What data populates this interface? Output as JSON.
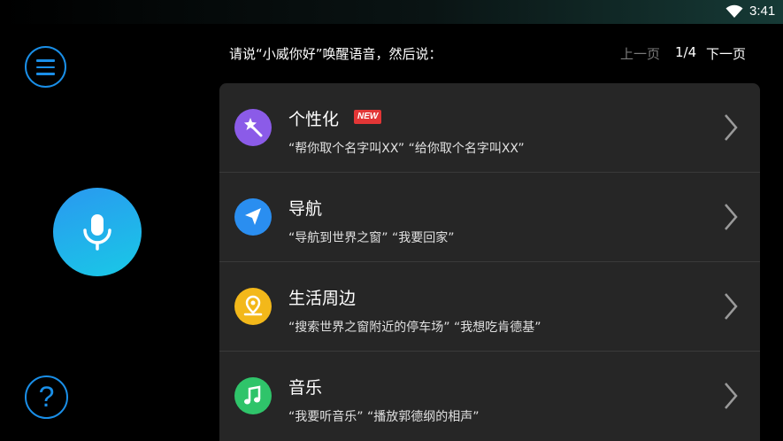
{
  "status_bar": {
    "time": "3:41",
    "wifi_icon": "wifi-icon"
  },
  "header": {
    "hint": "请说“小威你好”唤醒语音，然后说：",
    "prev_label": "上一页",
    "page_indicator": "1/4",
    "next_label": "下一页"
  },
  "sidebar": {
    "menu_icon": "hamburger-menu-icon",
    "mic_icon": "microphone-icon",
    "help_label": "?"
  },
  "items": [
    {
      "title": "个性化",
      "badge": "NEW",
      "subtitle": "“帮你取个名字叫XX” “给你取个名字叫XX”",
      "icon": "magic-wand-icon",
      "color": "#8b5be8"
    },
    {
      "title": "导航",
      "subtitle": "“导航到世界之窗” “我要回家”",
      "icon": "navigation-arrow-icon",
      "color": "#2a8ef0"
    },
    {
      "title": "生活周边",
      "subtitle": "“搜索世界之窗附近的停车场” “我想吃肯德基”",
      "icon": "location-pin-icon",
      "color": "#f3b81a"
    },
    {
      "title": "音乐",
      "subtitle": "“我要听音乐” “播放郭德纲的相声”",
      "icon": "music-note-icon",
      "color": "#2fc46a"
    }
  ]
}
